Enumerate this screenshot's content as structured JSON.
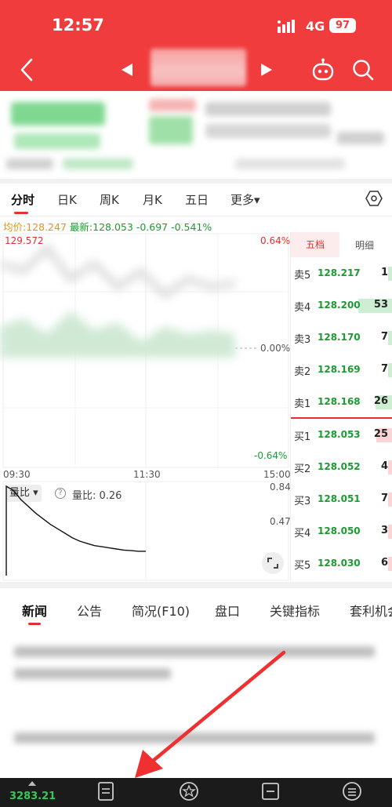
{
  "status": {
    "time": "12:57",
    "network": "4G",
    "battery": "97"
  },
  "chart_tabs": [
    "分时",
    "日K",
    "周K",
    "月K",
    "五日",
    "更多▾"
  ],
  "info": {
    "avg_label": "均价:",
    "avg_value": "128.247",
    "latest_label": "最新:",
    "latest_value": "128.053",
    "change": "-0.697",
    "change_pct": "-0.541%"
  },
  "chart": {
    "high_price": "129.572",
    "pct_top": "0.64%",
    "pct_mid": "0.00%",
    "pct_bottom": "-0.64%",
    "time_start": "09:30",
    "time_mid": "11:30",
    "time_end": "15:00",
    "volume_selector": "量比 ▾",
    "volume_text": "量比: 0.26",
    "vol_top": "0.84",
    "vol_mid": "0.47",
    "volume_ratio_series": [
      0.84,
      0.8,
      0.72,
      0.66,
      0.6,
      0.55,
      0.5,
      0.46,
      0.42,
      0.38,
      0.35,
      0.33,
      0.31,
      0.3,
      0.29,
      0.28,
      0.27,
      0.265,
      0.26,
      0.26
    ]
  },
  "book": {
    "tab_active": "五档",
    "tab_other": "明细",
    "sell": [
      {
        "label": "卖5",
        "price": "128.217",
        "qty": "1"
      },
      {
        "label": "卖4",
        "price": "128.200",
        "qty": "53"
      },
      {
        "label": "卖3",
        "price": "128.170",
        "qty": "7"
      },
      {
        "label": "卖2",
        "price": "128.169",
        "qty": "7"
      },
      {
        "label": "卖1",
        "price": "128.168",
        "qty": "26"
      }
    ],
    "buy": [
      {
        "label": "买1",
        "price": "128.053",
        "qty": "25"
      },
      {
        "label": "买2",
        "price": "128.052",
        "qty": "4"
      },
      {
        "label": "买3",
        "price": "128.051",
        "qty": "7"
      },
      {
        "label": "买4",
        "price": "128.050",
        "qty": "3"
      },
      {
        "label": "买5",
        "price": "128.030",
        "qty": "6"
      }
    ]
  },
  "news_tabs": [
    "新闻",
    "公告",
    "简况(F10)",
    "盘口",
    "关键指标",
    "套利机会"
  ],
  "bottom": {
    "index_value": "3283.21"
  },
  "colors": {
    "brand": "#f03c3c",
    "up": "#e23030",
    "down": "#1d9a33",
    "avg": "#d69a16"
  }
}
